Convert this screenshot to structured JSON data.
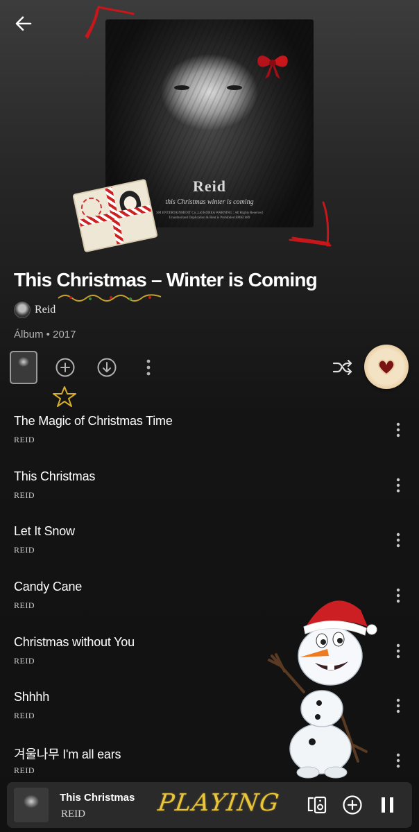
{
  "header": {
    "back_icon": "arrow-left-icon"
  },
  "cover": {
    "artist_text": "Reid",
    "subtitle": "this Christmas   winter is coming",
    "fine_print_1": "SM ENTERTAINMENT Co.,Ltd KOREA WARNING : All Rights Reserved",
    "fine_print_2": "Unauthorized Duplication & Rent is Prohibited  SMK1089"
  },
  "album": {
    "title": "This Christmas – Winter is Coming",
    "artist": "Reid",
    "meta": "Álbum • 2017"
  },
  "actions": {
    "add_icon": "plus-circle-icon",
    "download_icon": "download-circle-icon",
    "more_icon": "more-vertical-icon",
    "shuffle_icon": "shuffle-icon",
    "play_icon": "heart-cookie-icon"
  },
  "tracks": [
    {
      "title": "The Magic of Christmas Time",
      "artist": "REID"
    },
    {
      "title": "This Christmas",
      "artist": "REID"
    },
    {
      "title": "Let It Snow",
      "artist": "REID"
    },
    {
      "title": "Candy Cane",
      "artist": "REID"
    },
    {
      "title": "Christmas without You",
      "artist": "REID"
    },
    {
      "title": "Shhhh",
      "artist": "REID"
    },
    {
      "title": "겨울나무 I'm all ears",
      "artist": "REID"
    }
  ],
  "mini_player": {
    "title": "This Christmas",
    "artist": "REID",
    "status": "PLAYING",
    "devices_icon": "devices-icon",
    "add_icon": "plus-circle-icon",
    "pause_icon": "pause-icon"
  },
  "colors": {
    "background_top": "#3c3c3c",
    "background_bottom": "#111111",
    "text_secondary": "#b3b3b3",
    "player_bg": "#2a2a2a",
    "playing_gold": "#e9c53e",
    "doodle_red": "#c8161b"
  }
}
